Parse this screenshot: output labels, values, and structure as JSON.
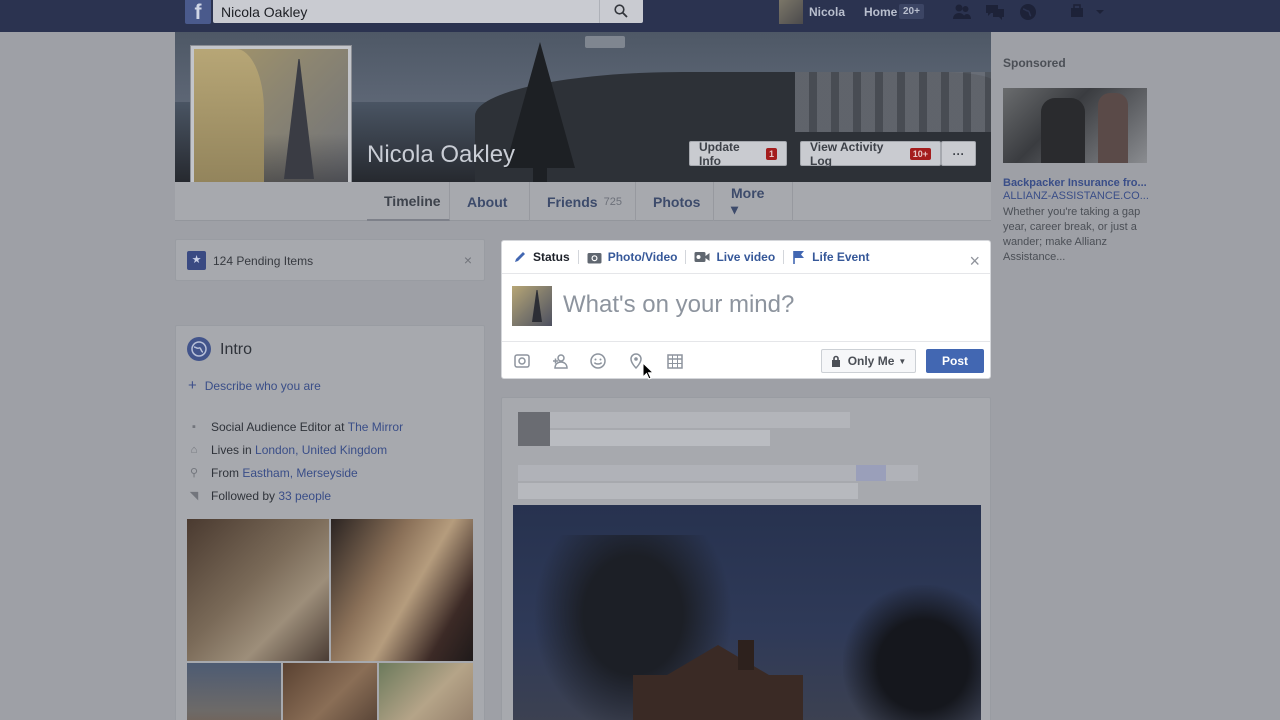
{
  "topbar": {
    "logo": "f",
    "search_value": "Nicola Oakley",
    "user_name": "Nicola",
    "home_label": "Home",
    "home_badge": "20+"
  },
  "profile": {
    "name": "Nicola Oakley",
    "update_info_label": "Update Info",
    "update_info_badge": "1",
    "activity_log_label": "View Activity Log",
    "activity_log_badge": "10+",
    "more_dots": "···"
  },
  "nav": {
    "timeline": "Timeline",
    "about": "About",
    "friends": "Friends",
    "friends_count": "725",
    "photos": "Photos",
    "more": "More ▾"
  },
  "pending": {
    "label": "124 Pending Items",
    "close": "×"
  },
  "intro": {
    "title": "Intro",
    "describe": "Describe who you are",
    "work_prefix": "Social Audience Editor at ",
    "work_link": "The Mirror",
    "lives_prefix": "Lives in ",
    "lives_link": "London, United Kingdom",
    "from_prefix": "From ",
    "from_link": "Eastham, Merseyside",
    "followed_prefix": "Followed by ",
    "followed_link": "33 people"
  },
  "composer": {
    "tabs": [
      "Status",
      "Photo/Video",
      "Live video",
      "Life Event"
    ],
    "placeholder": "What's on your mind?",
    "audience": "Only Me",
    "post_label": "Post",
    "close": "×"
  },
  "sponsored": {
    "heading": "Sponsored",
    "ad_title": "Backpacker Insurance fro...",
    "ad_url": "ALLIANZ-ASSISTANCE.CO...",
    "ad_body": "Whether you're taking a gap year, career break, or just a wander; make Allianz Assistance..."
  }
}
